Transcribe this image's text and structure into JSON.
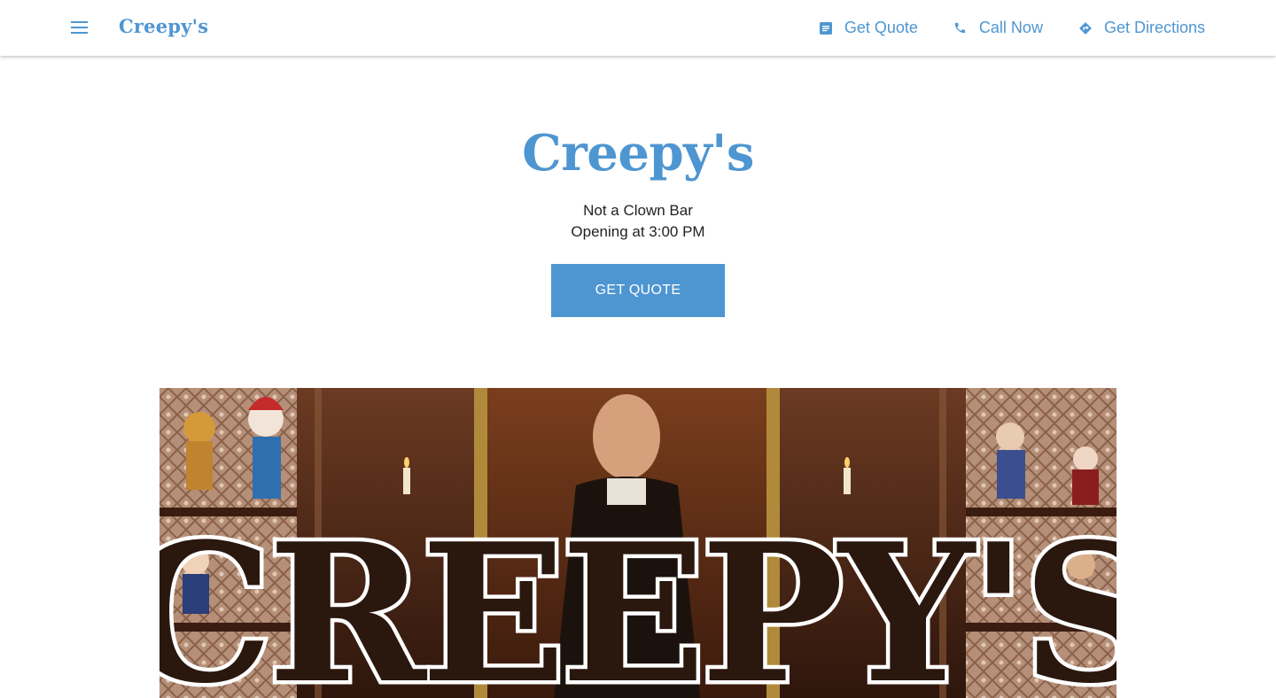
{
  "header": {
    "brand": "Creepy's",
    "menu_icon": "hamburger-menu-icon",
    "actions": [
      {
        "label": "Get Quote",
        "icon": "document-icon"
      },
      {
        "label": "Call Now",
        "icon": "phone-icon"
      },
      {
        "label": "Get Directions",
        "icon": "directions-icon"
      }
    ]
  },
  "hero": {
    "title": "Creepy's",
    "tagline": "Not a Clown Bar",
    "hours": "Opening at 3:00 PM",
    "cta_label": "GET QUOTE"
  },
  "banner": {
    "sign_text": "CREEPY'S",
    "alt": "Interior of Creepy's bar with dolls, toys and a portrait behind a large white CREEPY'S sign"
  },
  "colors": {
    "accent": "#4e96d1",
    "text": "#222222",
    "background": "#ffffff"
  }
}
